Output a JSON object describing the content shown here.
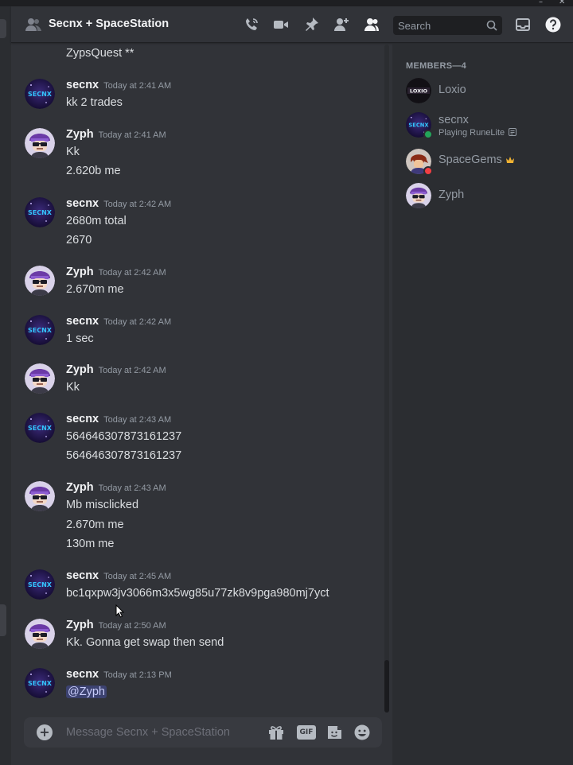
{
  "window": {
    "minimize": "–",
    "close": "✕"
  },
  "header": {
    "title": "Secnx + SpaceStation",
    "title_icon": "group-dm-icon",
    "icons": [
      "start-voice-call-icon",
      "start-video-call-icon",
      "pinned-messages-icon",
      "add-friends-icon",
      "hide-member-list-icon",
      "inbox-icon",
      "help-icon"
    ],
    "search_placeholder": "Search"
  },
  "messages": [
    {
      "author": "",
      "time": "",
      "lines": [
        "ZypsQuest **"
      ]
    },
    {
      "author": "secnx",
      "time": "Today at 2:41 AM",
      "lines": [
        "kk 2 trades"
      ]
    },
    {
      "author": "Zyph",
      "time": "Today at 2:41 AM",
      "lines": [
        "Kk",
        "2.620b me"
      ]
    },
    {
      "author": "secnx",
      "time": "Today at 2:42 AM",
      "lines": [
        "2680m total",
        "2670"
      ]
    },
    {
      "author": "Zyph",
      "time": "Today at 2:42 AM",
      "lines": [
        "2.670m me"
      ]
    },
    {
      "author": "secnx",
      "time": "Today at 2:42 AM",
      "lines": [
        "1 sec"
      ]
    },
    {
      "author": "Zyph",
      "time": "Today at 2:42 AM",
      "lines": [
        "Kk"
      ]
    },
    {
      "author": "secnx",
      "time": "Today at 2:43 AM",
      "lines": [
        "564646307873161237",
        "564646307873161237"
      ]
    },
    {
      "author": "Zyph",
      "time": "Today at 2:43 AM",
      "lines": [
        "Mb misclicked",
        "2.670m me",
        "130m me"
      ]
    },
    {
      "author": "secnx",
      "time": "Today at 2:45 AM",
      "lines": [
        "bc1qxpw3jv3066m3x5wg85u77zk8v9pga980mj7yct"
      ]
    },
    {
      "author": "Zyph",
      "time": "Today at 2:50 AM",
      "lines": [
        "Kk. Gonna get swap then send"
      ]
    },
    {
      "author": "secnx",
      "time": "Today at 2:13 PM",
      "mention": "@Zyph"
    }
  ],
  "composer": {
    "placeholder": "Message Secnx + SpaceStation",
    "gif_label": "GIF",
    "icons": [
      "upload-plus-icon",
      "gift-icon",
      "gif-picker-icon",
      "sticker-icon",
      "emoji-icon"
    ]
  },
  "members": {
    "heading": "MEMBERS—4",
    "list": [
      {
        "name": "Loxio",
        "activity": "",
        "avatar_text": "LOXIO"
      },
      {
        "name": "secnx",
        "activity": "Playing RuneLite",
        "avatar_text": "SECNX",
        "status": "online"
      },
      {
        "name": "SpaceGems",
        "activity": "",
        "badge": "crown-icon",
        "status": "dnd"
      },
      {
        "name": "Zyph",
        "activity": ""
      }
    ]
  },
  "avatar_label": "SECNX",
  "colors": {
    "accent": "#5865f2",
    "online": "#23a55a",
    "dnd": "#f23f43",
    "crown": "#f0b232"
  }
}
